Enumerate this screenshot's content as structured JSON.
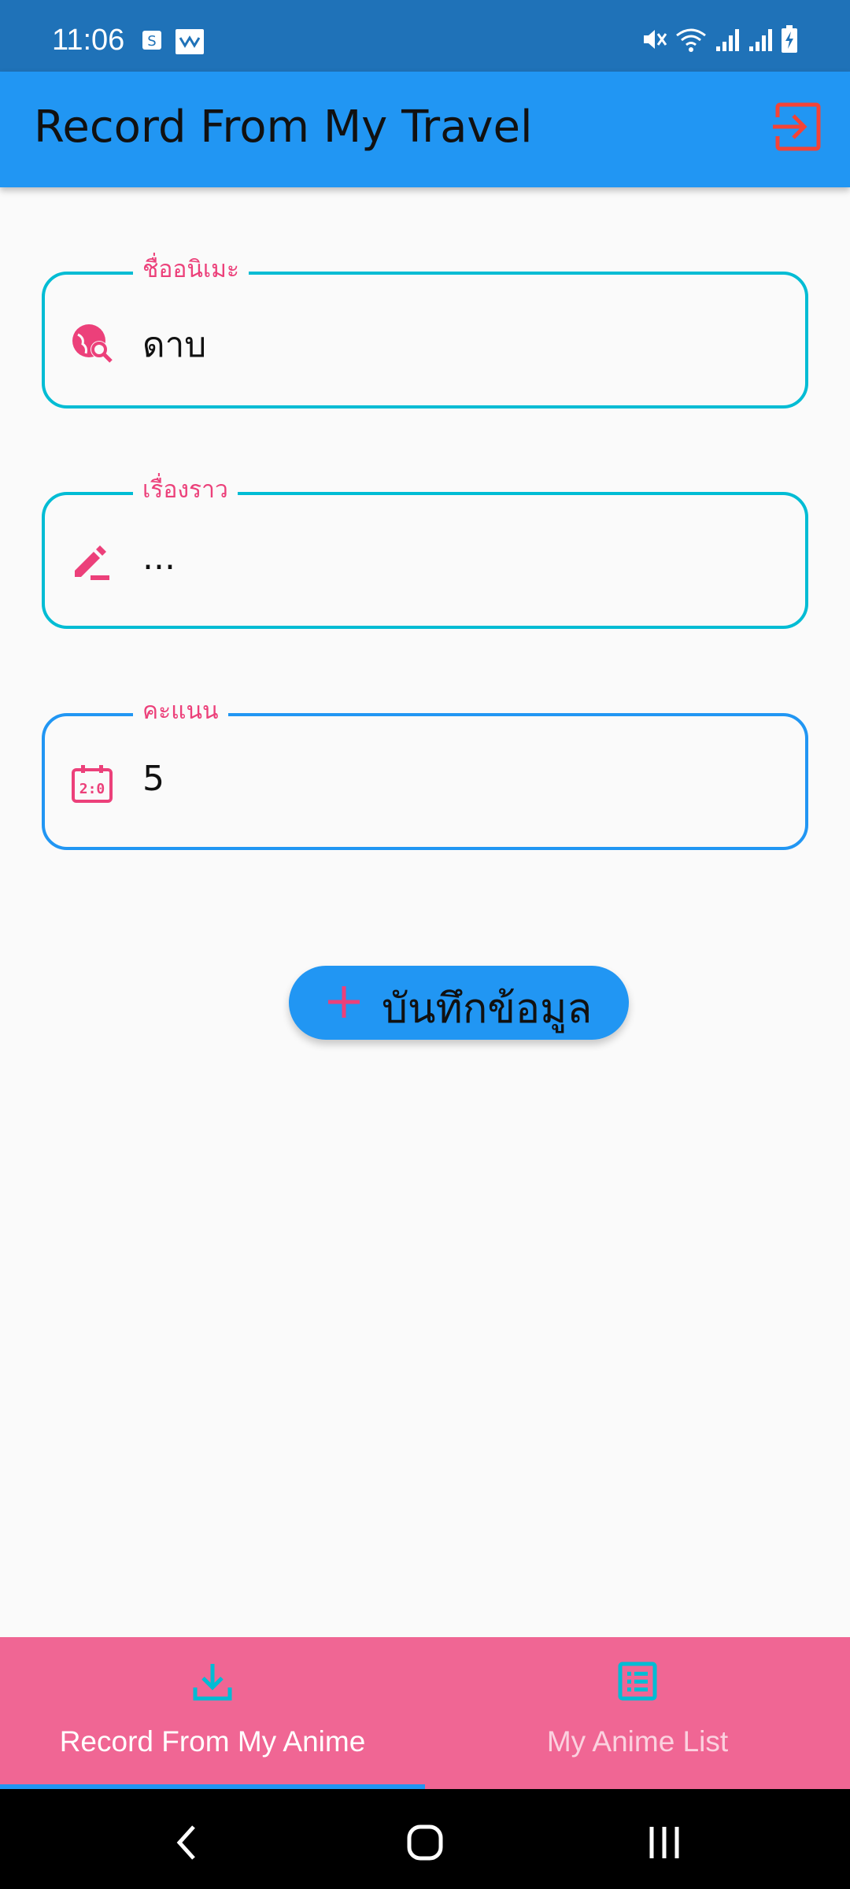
{
  "status_bar": {
    "time": "11:06",
    "left_icons": [
      "sim-card-icon",
      "wallet-icon"
    ],
    "right_icons": [
      "mute-icon",
      "wifi-icon",
      "signal-icon",
      "signal-icon",
      "battery-charging-icon"
    ]
  },
  "app_bar": {
    "title": "Record From My Travel",
    "logout_icon": "logout-icon"
  },
  "form": {
    "name_field": {
      "label": "ชื่ออนิเมะ",
      "value": "ดาบ",
      "icon": "travel-explore-icon"
    },
    "story_field": {
      "label": "เรื่องราว",
      "value": "...",
      "icon": "edit-icon"
    },
    "score_field": {
      "label": "คะแนน",
      "value": "5",
      "icon": "scoreboard-icon"
    }
  },
  "save_button": {
    "label": "บันทึกข้อมูล",
    "icon": "plus-icon"
  },
  "bottom_nav": {
    "items": [
      {
        "label": "Record From My Anime",
        "icon": "download-icon",
        "active": true
      },
      {
        "label": "My Anime List",
        "icon": "list-icon",
        "active": false
      }
    ]
  },
  "colors": {
    "primary": "#2196f3",
    "accent_pink": "#ec407a",
    "outline_cyan": "#00bcd4",
    "nav_background": "#f06694",
    "logout_red": "#f44336"
  }
}
